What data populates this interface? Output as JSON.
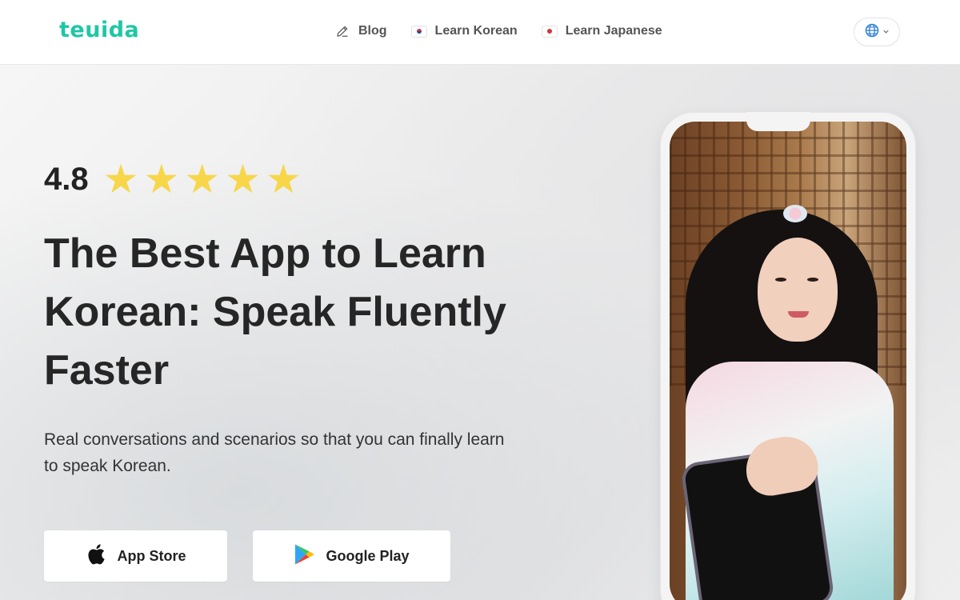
{
  "header": {
    "logo": "teuida",
    "nav": [
      {
        "label": "Blog",
        "icon": "pencil-icon"
      },
      {
        "label": "Learn Korean",
        "icon": "korea-flag-icon"
      },
      {
        "label": "Learn Japanese",
        "icon": "japan-flag-icon"
      }
    ],
    "language_button": {
      "icon": "globe-icon",
      "caret": "chevron-down-icon"
    }
  },
  "hero": {
    "rating": {
      "value": "4.8",
      "stars": 5,
      "star_color": "#f7d64a"
    },
    "headline": "The Best App to Learn Korean: Speak Fluently Faster",
    "subtext": "Real conversations and scenarios so that you can finally learn to speak Korean.",
    "buttons": [
      {
        "label": "App Store",
        "icon": "apple-icon"
      },
      {
        "label": "Google Play",
        "icon": "google-play-icon"
      }
    ]
  },
  "colors": {
    "brand": "#1fc7a6",
    "text_dark": "#262626",
    "nav_text": "#555555",
    "globe_blue": "#2f7fd8"
  }
}
